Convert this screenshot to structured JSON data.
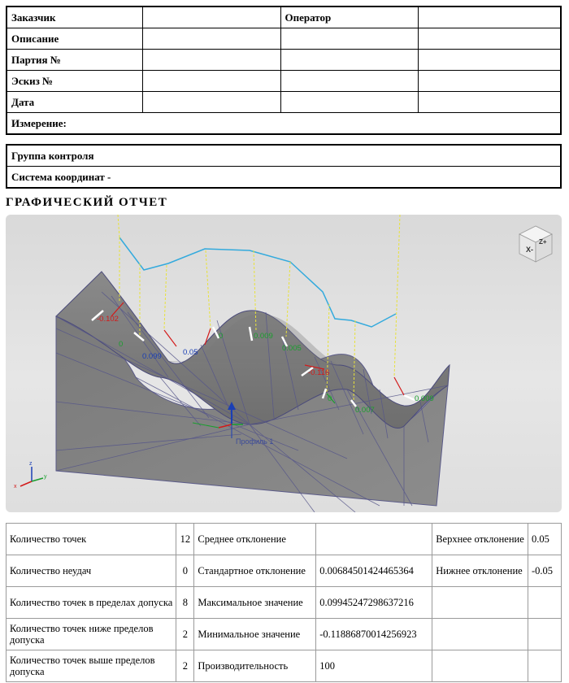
{
  "header": {
    "customer_label": "Заказчик",
    "operator_label": "Оператор",
    "description_label": "Описание",
    "batch_label": "Партия №",
    "sketch_label": "Эскиз №",
    "date_label": "Дата",
    "measurement_label": "Измерение:"
  },
  "control": {
    "group_label": "Группа контроля",
    "coord_label": "Система координат -"
  },
  "section_title": "ГРАФИЧЕСКИЙ ОТЧЕТ",
  "view": {
    "profile_label": "Профиль 1",
    "cube_label": "Z+ X-",
    "deviation_labels": [
      "-0.102",
      "0",
      "0.099",
      "0.05",
      "0",
      "0.009",
      "0.005",
      "-0.116",
      "0",
      "0.007",
      "0.009"
    ],
    "colors": {
      "positive": "#1a9e2e",
      "negative": "#d31a1a",
      "blue": "#1a3fb5",
      "profile": "#33aadd",
      "needle": "#e8e23a"
    }
  },
  "stats": {
    "rows": [
      {
        "label": "Количество точек",
        "count": "12",
        "label2": "Среднее отклонение",
        "value": "",
        "label3": "Верхнее отклонение",
        "value3": "0.05"
      },
      {
        "label": "Количество неудач",
        "count": "0",
        "label2": "Стандартное отклонение",
        "value": "0.00684501424465364",
        "label3": "Нижнее отклонение",
        "value3": "-0.05"
      },
      {
        "label": "Количество точек в пределах допуска",
        "count": "8",
        "label2": "Максимальное значение",
        "value": "0.09945247298637216",
        "label3": "",
        "value3": ""
      },
      {
        "label": "Количество точек ниже пределов допуска",
        "count": "2",
        "label2": "Минимальное значение",
        "value": "-0.11886870014256923",
        "label3": "",
        "value3": ""
      },
      {
        "label": "Количество точек выше пределов допуска",
        "count": "2",
        "label2": "Производительность",
        "value": "100",
        "label3": "",
        "value3": ""
      }
    ]
  }
}
